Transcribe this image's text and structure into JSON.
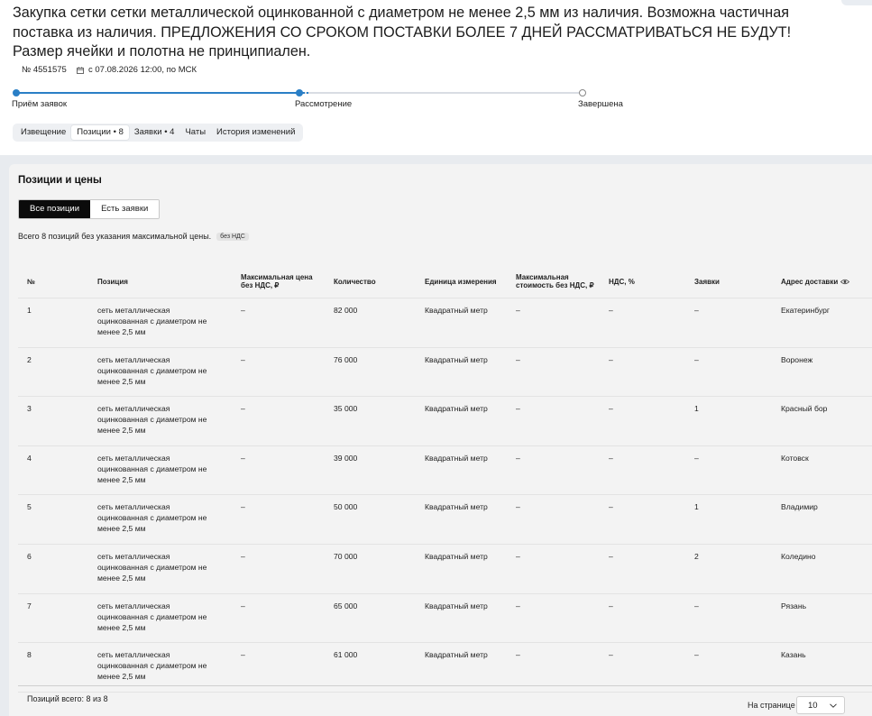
{
  "header": {
    "title": "Закупка сетки сетки металлической оцинкованной с диаметром не менее 2,5 мм из наличия. Возможна частичная поставка из наличия. ПРЕДЛОЖЕНИЯ СО СРОКОМ ПОСТАВКИ БОЛЕЕ 7 ДНЕЙ РАССМАТРИВАТЬСЯ НЕ БУДУТ! Размер ячейки и полотна не принципиален.",
    "number": "№ 4551575",
    "date": "с 07.08.2026 12:00, по МСК"
  },
  "progress": {
    "stages": [
      "Приём заявок",
      "Рассмотрение",
      "Завершена"
    ],
    "current_stage": 2
  },
  "tabs": [
    {
      "label": "Извещение"
    },
    {
      "label": "Позиции • 8"
    },
    {
      "label": "Заявки • 4"
    },
    {
      "label": "Чаты"
    },
    {
      "label": "История изменений"
    }
  ],
  "active_tab": 1,
  "panel": {
    "title": "Позиции и цены",
    "filters": [
      "Все позиции",
      "Есть заявки"
    ],
    "active_filter": 0,
    "summary": "Всего 8 позиций без указания максимальной цены.",
    "vat_badge": "без НДС"
  },
  "table": {
    "columns": [
      "№",
      "Позиция",
      "Максимальная цена без НДС, ₽",
      "Количество",
      "Единица измерения",
      "Максимальная стоимость без НДС, ₽",
      "НДС, %",
      "Заявки",
      "Адрес доставки"
    ],
    "rows": [
      {
        "n": "1",
        "position": "сеть металлическая оцинкованная с диаметром не менее 2,5 мм",
        "max_price": "–",
        "qty": "82 000",
        "unit": "Квадратный метр",
        "max_cost": "–",
        "vat": "–",
        "bids": "–",
        "address": "Екатеринбург"
      },
      {
        "n": "2",
        "position": "сеть металлическая оцинкованная с диаметром не менее 2,5 мм",
        "max_price": "–",
        "qty": "76 000",
        "unit": "Квадратный метр",
        "max_cost": "–",
        "vat": "–",
        "bids": "–",
        "address": "Воронеж"
      },
      {
        "n": "3",
        "position": "сеть металлическая оцинкованная с диаметром не менее 2,5 мм",
        "max_price": "–",
        "qty": "35 000",
        "unit": "Квадратный метр",
        "max_cost": "–",
        "vat": "–",
        "bids": "1",
        "address": "Красный бор"
      },
      {
        "n": "4",
        "position": "сеть металлическая оцинкованная с диаметром не менее 2,5 мм",
        "max_price": "–",
        "qty": "39 000",
        "unit": "Квадратный метр",
        "max_cost": "–",
        "vat": "–",
        "bids": "–",
        "address": "Котовск"
      },
      {
        "n": "5",
        "position": "сеть металлическая оцинкованная с диаметром не менее 2,5 мм",
        "max_price": "–",
        "qty": "50 000",
        "unit": "Квадратный метр",
        "max_cost": "–",
        "vat": "–",
        "bids": "1",
        "address": "Владимир"
      },
      {
        "n": "6",
        "position": "сеть металлическая оцинкованная с диаметром не менее 2,5 мм",
        "max_price": "–",
        "qty": "70 000",
        "unit": "Квадратный метр",
        "max_cost": "–",
        "vat": "–",
        "bids": "2",
        "address": "Коледино"
      },
      {
        "n": "7",
        "position": "сеть металлическая оцинкованная с диаметром не менее 2,5 мм",
        "max_price": "–",
        "qty": "65 000",
        "unit": "Квадратный метр",
        "max_cost": "–",
        "vat": "–",
        "bids": "–",
        "address": "Рязань"
      },
      {
        "n": "8",
        "position": "сеть металлическая оцинкованная с диаметром не менее 2,5 мм",
        "max_price": "–",
        "qty": "61 000",
        "unit": "Квадратный метр",
        "max_cost": "–",
        "vat": "–",
        "bids": "–",
        "address": "Казань"
      }
    ]
  },
  "footer": {
    "total": "Позиций всего: 8 из 8",
    "per_page_label": "На странице",
    "per_page_value": "10"
  },
  "colors": {
    "accent": "#2a7fc6",
    "panel_bg": "#f3f3f3",
    "active_filter_bg": "#0b0b0b"
  },
  "icons": [
    "calendar-icon",
    "eye-icon",
    "chevron-down-icon"
  ]
}
